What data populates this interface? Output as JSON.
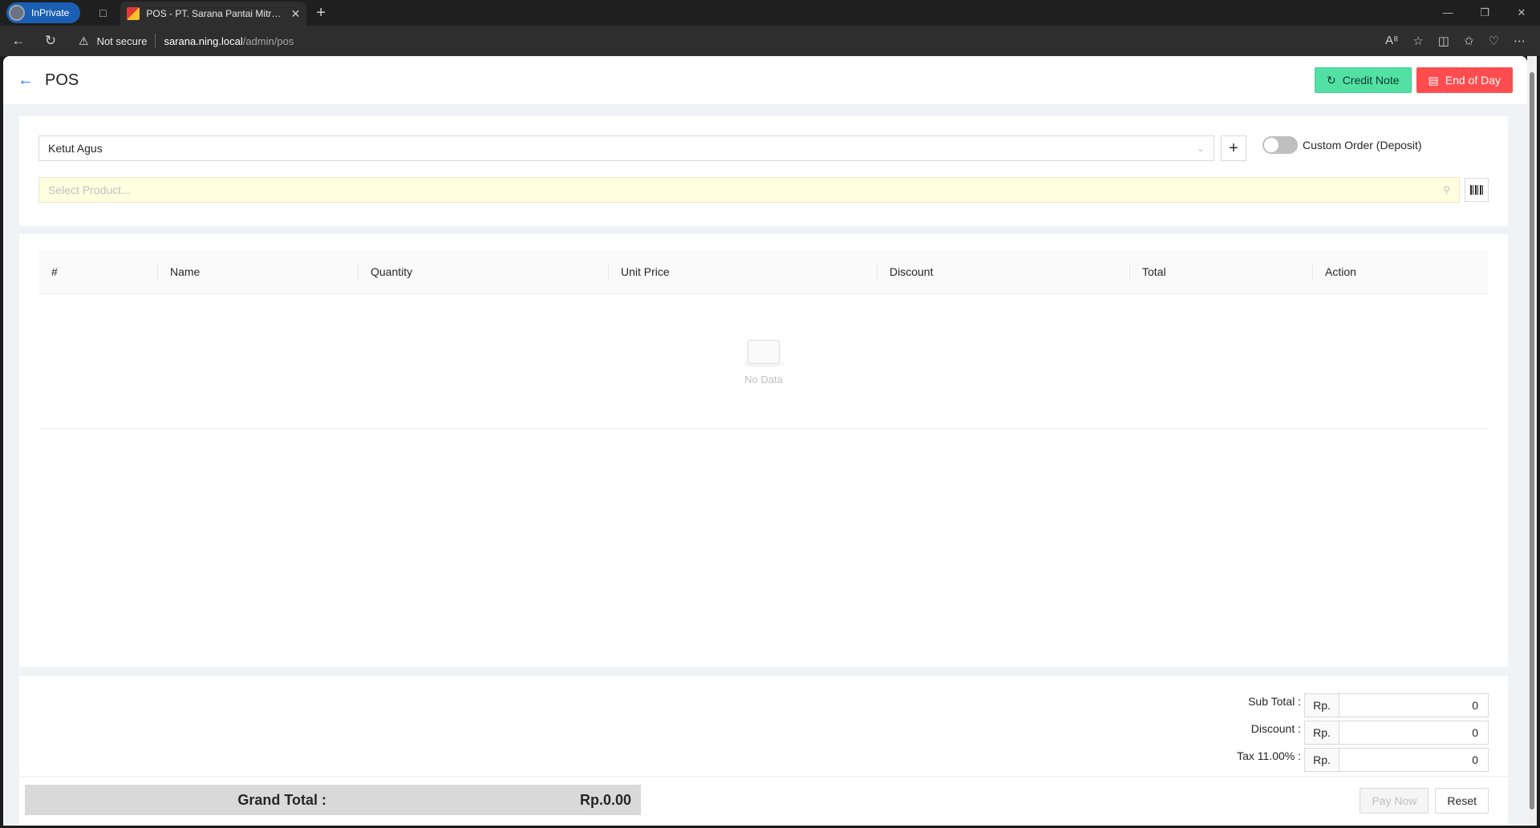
{
  "browser": {
    "inprivate_label": "InPrivate",
    "tab_title": "POS - PT. Sarana Pantai Mitra Se",
    "security_label": "Not secure",
    "url_host": "sarana.ning.local",
    "url_path": "/admin/pos"
  },
  "header": {
    "title": "POS",
    "credit_note_label": "Credit Note",
    "end_of_day_label": "End of Day"
  },
  "order": {
    "customer_value": "Ketut Agus",
    "custom_order_label": "Custom Order (Deposit)",
    "custom_order_enabled": false,
    "product_placeholder": "Select Product..."
  },
  "table": {
    "columns": [
      "#",
      "Name",
      "Quantity",
      "Unit Price",
      "Discount",
      "Total",
      "Action"
    ],
    "empty_text": "No Data"
  },
  "summary": {
    "sub_total_label": "Sub Total :",
    "sub_total_currency": "Rp.",
    "sub_total_value": "0",
    "discount_label": "Discount :",
    "discount_currency": "Rp.",
    "discount_value": "0",
    "tax_label": "Tax 11.00% :",
    "tax_currency": "Rp.",
    "tax_value": "0",
    "grand_total_label": "Grand Total :",
    "grand_total_value": "Rp.0.00",
    "pay_now_label": "Pay Now",
    "reset_label": "Reset"
  }
}
